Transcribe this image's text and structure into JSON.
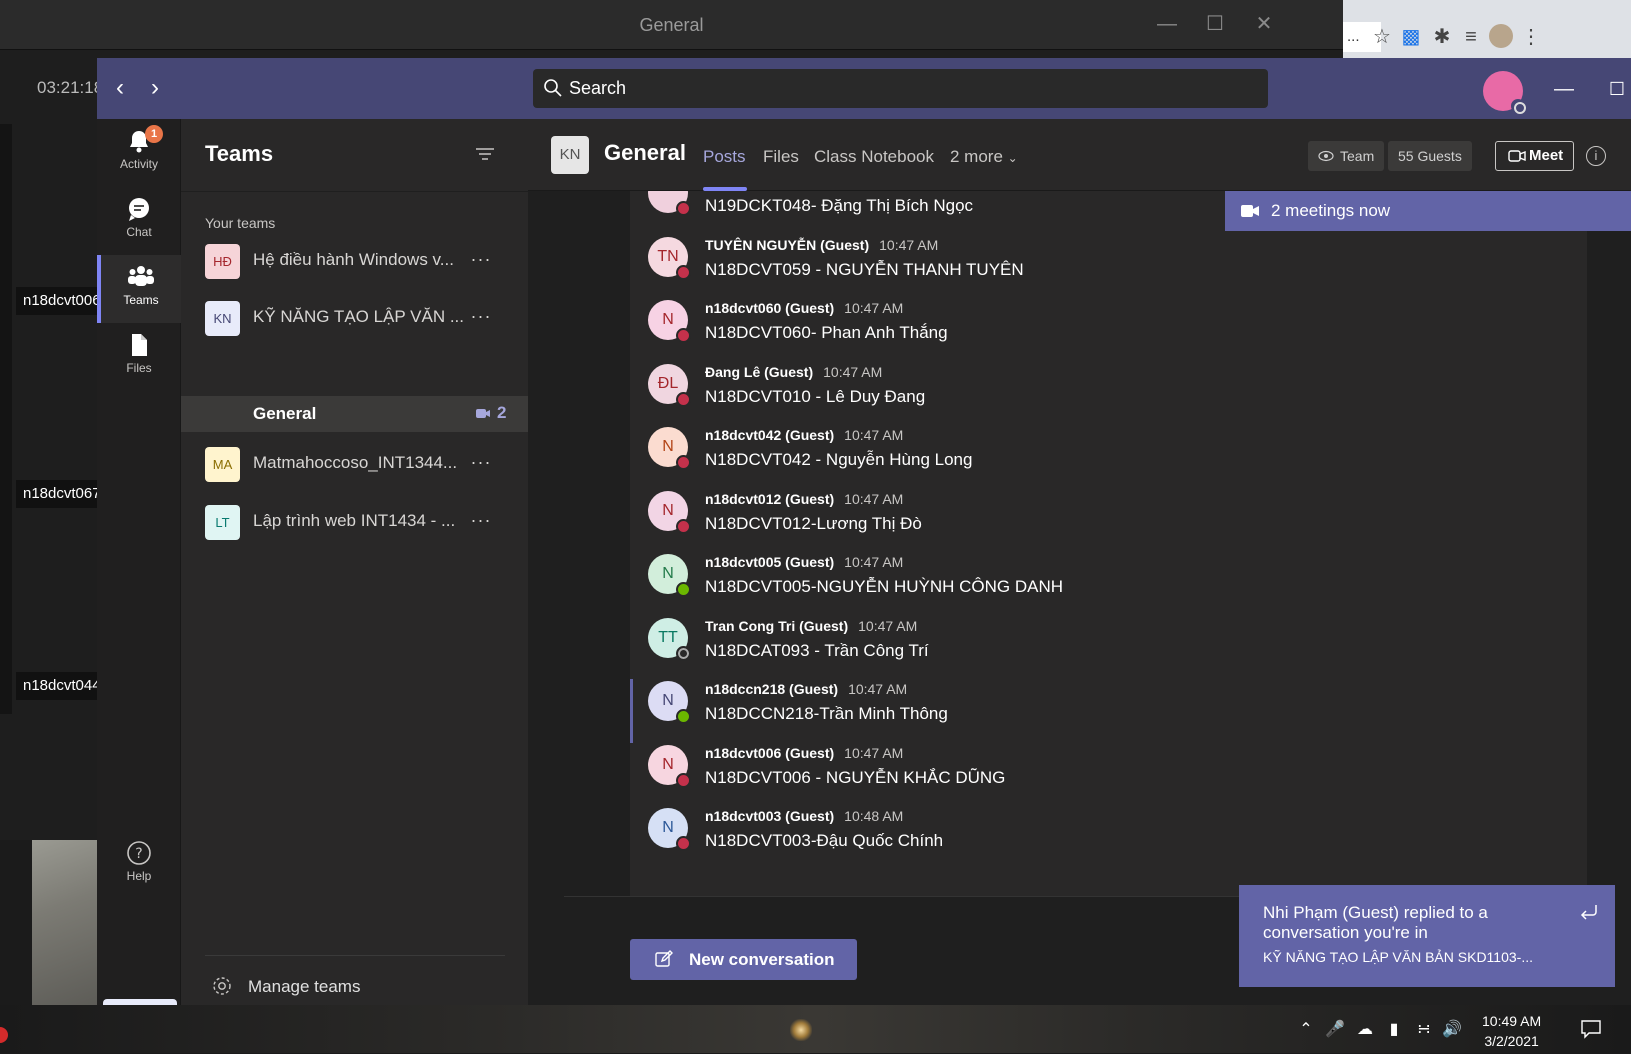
{
  "background": {
    "window_title": "General",
    "call_time": "03:21:18",
    "participant_labels": [
      "n18dcvt006",
      "n18dcvt067",
      "n18dcvt044"
    ],
    "browser_addr": "..."
  },
  "topbar": {
    "search_placeholder": "Search"
  },
  "rail": {
    "activity": {
      "label": "Activity",
      "badge": "1"
    },
    "chat": {
      "label": "Chat"
    },
    "teams": {
      "label": "Teams"
    },
    "files": {
      "label": "Files"
    },
    "help": {
      "label": "Help"
    }
  },
  "panel": {
    "title": "Teams",
    "section_label": "Your teams",
    "teams": [
      {
        "initials": "HĐ",
        "name": "Hệ điều hành Windows v...",
        "av_bg": "#f6d4d8",
        "av_fg": "#a4262c"
      },
      {
        "initials": "KN",
        "name": "KỸ NĂNG TẠO LẬP VĂN ...",
        "av_bg": "#e8ebfa",
        "av_fg": "#464775"
      },
      {
        "initials": "MA",
        "name": "Matmahoccoso_INT1344...",
        "av_bg": "#fff4ce",
        "av_fg": "#8a6d00"
      },
      {
        "initials": "LT",
        "name": "Lập trình web INT1434 - ...",
        "av_bg": "#e0f5f3",
        "av_fg": "#0a7a70"
      }
    ],
    "more_glyph": "···",
    "active_channel": {
      "name": "General",
      "meeting_count": "2"
    },
    "manage_label": "Manage teams"
  },
  "channel": {
    "initials": "KN",
    "name": "General",
    "tabs": [
      "Posts",
      "Files",
      "Class Notebook",
      "2 more"
    ],
    "team_btn": "Team",
    "guests_btn": "55 Guests",
    "meet_btn": "Meet",
    "meetings_banner": "2 meetings now"
  },
  "messages": [
    {
      "initials": "",
      "sender": "",
      "time": "",
      "text": "N19DCKT048- Đặng Thị Bích Ngọc",
      "av_bg": "#f0d0dd",
      "av_fg": "#a4262c",
      "presence": "busy"
    },
    {
      "initials": "TN",
      "sender": "TUYÊN NGUYỄN (Guest)",
      "time": "10:47 AM",
      "text": "N18DCVT059 - NGUYỄN THANH TUYÊN",
      "av_bg": "#f5d9e0",
      "av_fg": "#a4262c",
      "presence": "busy"
    },
    {
      "initials": "N",
      "sender": "n18dcvt060 (Guest)",
      "time": "10:47 AM",
      "text": "N18DCVT060- Phan Anh Thắng",
      "av_bg": "#f7d2e4",
      "av_fg": "#a4262c",
      "presence": "busy"
    },
    {
      "initials": "ĐL",
      "sender": "Đang Lê (Guest)",
      "time": "10:47 AM",
      "text": "N18DCVT010 - Lê Duy Đang",
      "av_bg": "#f0d6e0",
      "av_fg": "#a4262c",
      "presence": "busy"
    },
    {
      "initials": "N",
      "sender": "n18dcvt042 (Guest)",
      "time": "10:47 AM",
      "text": "N18DCVT042 - Nguyễn Hùng Long",
      "av_bg": "#fbdcd0",
      "av_fg": "#b34416",
      "presence": "busy"
    },
    {
      "initials": "N",
      "sender": "n18dcvt012 (Guest)",
      "time": "10:47 AM",
      "text": "N18DCVT012-Lương Thị Đò",
      "av_bg": "#f2d5e5",
      "av_fg": "#a4262c",
      "presence": "busy"
    },
    {
      "initials": "N",
      "sender": "n18dcvt005 (Guest)",
      "time": "10:47 AM",
      "text": "N18DCVT005-NGUYỄN HUỲNH CÔNG DANH",
      "av_bg": "#d2eedb",
      "av_fg": "#237b4b",
      "presence": "available"
    },
    {
      "initials": "TT",
      "sender": "Tran Cong Tri (Guest)",
      "time": "10:47 AM",
      "text": "N18DCAT093 - Trần Công Trí",
      "av_bg": "#cfeee5",
      "av_fg": "#0a7a62",
      "presence": "offline"
    },
    {
      "initials": "N",
      "sender": "n18dccn218 (Guest)",
      "time": "10:47 AM",
      "text": "N18DCCN218-Trần Minh Thông",
      "av_bg": "#dcdcf4",
      "av_fg": "#464775",
      "presence": "available"
    },
    {
      "initials": "N",
      "sender": "n18dcvt006 (Guest)",
      "time": "10:47 AM",
      "text": "N18DCVT006 - NGUYỄN KHẮC DŨNG",
      "av_bg": "#f7d6e0",
      "av_fg": "#a4262c",
      "presence": "busy"
    },
    {
      "initials": "N",
      "sender": "n18dcvt003 (Guest)",
      "time": "10:48 AM",
      "text": "N18DCVT003-Đậu Quốc Chính",
      "av_bg": "#d6e0f5",
      "av_fg": "#2b5797",
      "presence": "busy"
    }
  ],
  "compose": {
    "new_conversation": "New conversation"
  },
  "toast": {
    "line1": "Nhi Phạm (Guest) replied to a conversation you're in",
    "line2": "KỸ NĂNG TẠO LẬP VĂN BẢN SKD1103-..."
  },
  "taskbar": {
    "time": "10:49 AM",
    "date": "3/2/2021"
  },
  "colors": {
    "accent": "#6264a7",
    "topbar": "#464775",
    "busy": "#c4314b",
    "available": "#6bb700"
  }
}
